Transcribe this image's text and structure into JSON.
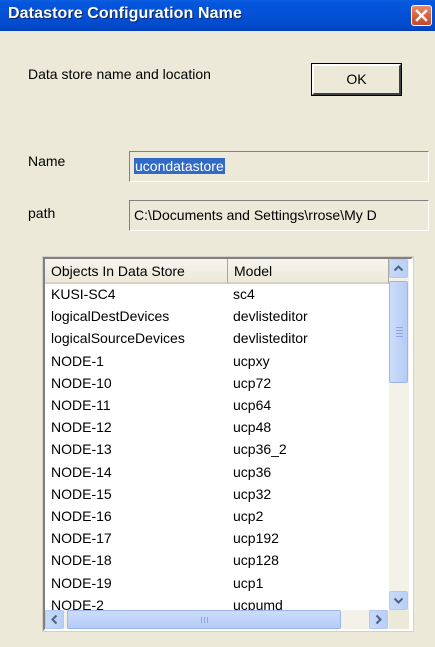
{
  "window": {
    "title": "Datastore Configuration Name"
  },
  "dialog": {
    "description": "Data store name and location",
    "ok_label": "OK",
    "name_label": "Name",
    "name_value": "ucondatastore",
    "path_label": "path",
    "path_value": "C:\\Documents and Settings\\rrose\\My D"
  },
  "table": {
    "columns": [
      "Objects In Data Store",
      "Model"
    ],
    "rows": [
      [
        "KUSI-SC4",
        "sc4"
      ],
      [
        "logicalDestDevices",
        "devlisteditor"
      ],
      [
        "logicalSourceDevices",
        "devlisteditor"
      ],
      [
        "NODE-1",
        "ucpxy"
      ],
      [
        "NODE-10",
        "ucp72"
      ],
      [
        "NODE-11",
        "ucp64"
      ],
      [
        "NODE-12",
        "ucp48"
      ],
      [
        "NODE-13",
        "ucp36_2"
      ],
      [
        "NODE-14",
        "ucp36"
      ],
      [
        "NODE-15",
        "ucp32"
      ],
      [
        "NODE-16",
        "ucp2"
      ],
      [
        "NODE-17",
        "ucp192"
      ],
      [
        "NODE-18",
        "ucp128"
      ],
      [
        "NODE-19",
        "ucp1"
      ],
      [
        "NODE-2",
        "ucpumd"
      ]
    ]
  },
  "colors": {
    "title_bar": "#0452d8",
    "close_button": "#d55b3a",
    "selection": "#316ac5",
    "window_bg": "#ece9d8",
    "scrollbar": "#b8cff8"
  },
  "icons": {
    "close": "close-icon",
    "up": "scroll-up-arrow-icon",
    "down": "scroll-down-arrow-icon",
    "left": "scroll-left-arrow-icon",
    "right": "scroll-right-arrow-icon"
  }
}
